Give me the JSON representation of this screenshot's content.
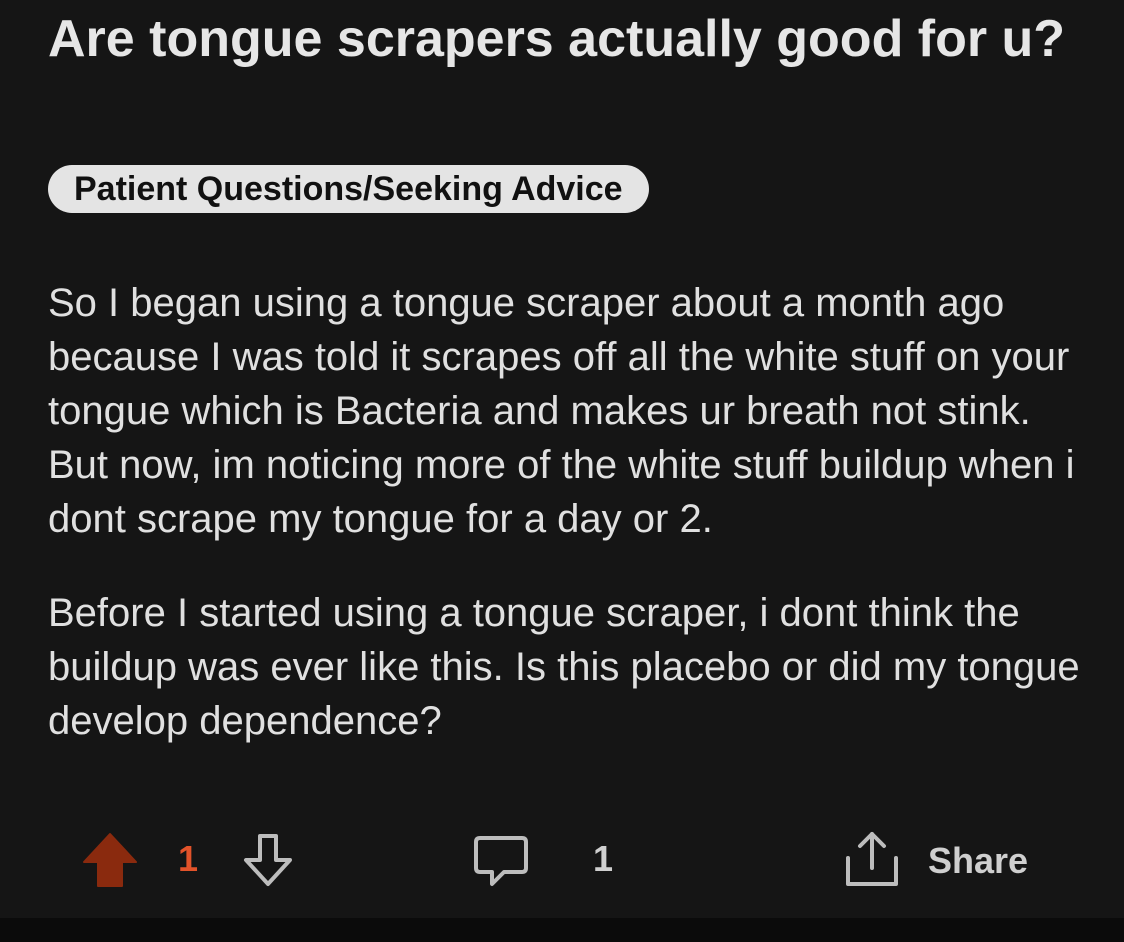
{
  "post": {
    "title": "Are tongue scrapers actually good for u?",
    "flair": "Patient Questions/Seeking Advice",
    "paragraphs": [
      "So I began using a tongue scraper about a month ago because I was told it scrapes off all the white stuff on your tongue which is Bacteria and makes ur breath not stink. But now, im noticing more of the white stuff buildup when i dont scrape my tongue for a day or 2.",
      "Before I started using a tongue scraper, i dont think the buildup was ever like this. Is this placebo or did my tongue develop dependence?"
    ]
  },
  "actions": {
    "vote_count": "1",
    "comment_count": "1",
    "share_label": "Share",
    "upvote_icon": "upvote-arrow-icon",
    "downvote_icon": "downvote-arrow-icon",
    "comment_icon": "comment-bubble-icon",
    "share_icon": "share-upload-icon"
  },
  "colors": {
    "background": "#151515",
    "upvote_active": "#8a2a0e",
    "vote_count": "#e2532a",
    "flair_bg": "#e4e4e4"
  }
}
